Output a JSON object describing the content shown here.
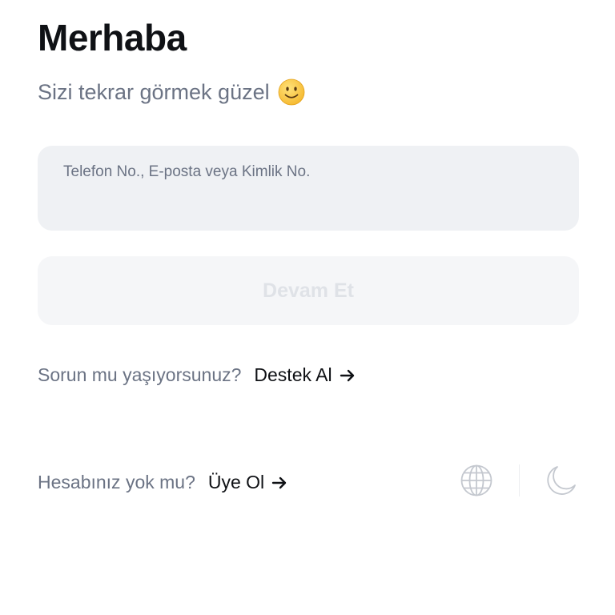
{
  "header": {
    "title": "Merhaba",
    "subtitle": "Sizi tekrar görmek güzel",
    "subtitle_icon": "smile-emoji-icon"
  },
  "login_form": {
    "identifier_placeholder": "Telefon No., E-posta veya Kimlik No.",
    "identifier_value": "",
    "continue_label": "Devam Et"
  },
  "support": {
    "question": "Sorun mu yaşıyorsunuz?",
    "link_label": "Destek Al"
  },
  "signup": {
    "question": "Hesabınız yok mu?",
    "link_label": "Üye Ol"
  },
  "footer_icons": {
    "language": "globe-icon",
    "theme": "moon-icon"
  },
  "colors": {
    "text": "#0f1115",
    "muted": "#6b7384",
    "input_bg": "#eff1f4",
    "button_bg_disabled": "#f5f6f8",
    "button_text_disabled": "#dfe2e7",
    "icon_gray": "#c4c8cf"
  }
}
